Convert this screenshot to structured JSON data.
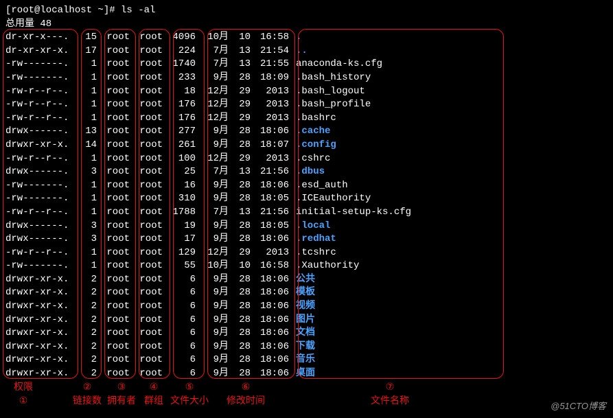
{
  "prompt": "[root@localhost ~]# ls -al",
  "total": "总用量 48",
  "rows": [
    {
      "perm": "dr-xr-x---.",
      "links": "15",
      "owner": "root",
      "group": "root",
      "size": "4096",
      "month": "10月",
      "day": "10",
      "time": "16:58",
      "name": ".",
      "dir": true
    },
    {
      "perm": "dr-xr-xr-x.",
      "links": "17",
      "owner": "root",
      "group": "root",
      "size": "224",
      "month": "7月",
      "day": "13",
      "time": "21:54",
      "name": "..",
      "dir": true
    },
    {
      "perm": "-rw-------.",
      "links": "1",
      "owner": "root",
      "group": "root",
      "size": "1740",
      "month": "7月",
      "day": "13",
      "time": "21:55",
      "name": "anaconda-ks.cfg",
      "dir": false
    },
    {
      "perm": "-rw-------.",
      "links": "1",
      "owner": "root",
      "group": "root",
      "size": "233",
      "month": "9月",
      "day": "28",
      "time": "18:09",
      "name": ".bash_history",
      "dir": false
    },
    {
      "perm": "-rw-r--r--.",
      "links": "1",
      "owner": "root",
      "group": "root",
      "size": "18",
      "month": "12月",
      "day": "29",
      "time": "2013",
      "name": ".bash_logout",
      "dir": false
    },
    {
      "perm": "-rw-r--r--.",
      "links": "1",
      "owner": "root",
      "group": "root",
      "size": "176",
      "month": "12月",
      "day": "29",
      "time": "2013",
      "name": ".bash_profile",
      "dir": false
    },
    {
      "perm": "-rw-r--r--.",
      "links": "1",
      "owner": "root",
      "group": "root",
      "size": "176",
      "month": "12月",
      "day": "29",
      "time": "2013",
      "name": ".bashrc",
      "dir": false
    },
    {
      "perm": "drwx------.",
      "links": "13",
      "owner": "root",
      "group": "root",
      "size": "277",
      "month": "9月",
      "day": "28",
      "time": "18:06",
      "name": ".cache",
      "dir": true
    },
    {
      "perm": "drwxr-xr-x.",
      "links": "14",
      "owner": "root",
      "group": "root",
      "size": "261",
      "month": "9月",
      "day": "28",
      "time": "18:07",
      "name": ".config",
      "dir": true
    },
    {
      "perm": "-rw-r--r--.",
      "links": "1",
      "owner": "root",
      "group": "root",
      "size": "100",
      "month": "12月",
      "day": "29",
      "time": "2013",
      "name": ".cshrc",
      "dir": false
    },
    {
      "perm": "drwx------.",
      "links": "3",
      "owner": "root",
      "group": "root",
      "size": "25",
      "month": "7月",
      "day": "13",
      "time": "21:56",
      "name": ".dbus",
      "dir": true
    },
    {
      "perm": "-rw-------.",
      "links": "1",
      "owner": "root",
      "group": "root",
      "size": "16",
      "month": "9月",
      "day": "28",
      "time": "18:06",
      "name": ".esd_auth",
      "dir": false
    },
    {
      "perm": "-rw-------.",
      "links": "1",
      "owner": "root",
      "group": "root",
      "size": "310",
      "month": "9月",
      "day": "28",
      "time": "18:05",
      "name": ".ICEauthority",
      "dir": false
    },
    {
      "perm": "-rw-r--r--.",
      "links": "1",
      "owner": "root",
      "group": "root",
      "size": "1788",
      "month": "7月",
      "day": "13",
      "time": "21:56",
      "name": "initial-setup-ks.cfg",
      "dir": false
    },
    {
      "perm": "drwx------.",
      "links": "3",
      "owner": "root",
      "group": "root",
      "size": "19",
      "month": "9月",
      "day": "28",
      "time": "18:05",
      "name": ".local",
      "dir": true
    },
    {
      "perm": "drwx------.",
      "links": "3",
      "owner": "root",
      "group": "root",
      "size": "17",
      "month": "9月",
      "day": "28",
      "time": "18:06",
      "name": ".redhat",
      "dir": true
    },
    {
      "perm": "-rw-r--r--.",
      "links": "1",
      "owner": "root",
      "group": "root",
      "size": "129",
      "month": "12月",
      "day": "29",
      "time": "2013",
      "name": ".tcshrc",
      "dir": false
    },
    {
      "perm": "-rw-------.",
      "links": "1",
      "owner": "root",
      "group": "root",
      "size": "55",
      "month": "10月",
      "day": "10",
      "time": "16:58",
      "name": ".Xauthority",
      "dir": false
    },
    {
      "perm": "drwxr-xr-x.",
      "links": "2",
      "owner": "root",
      "group": "root",
      "size": "6",
      "month": "9月",
      "day": "28",
      "time": "18:06",
      "name": "公共",
      "dir": true
    },
    {
      "perm": "drwxr-xr-x.",
      "links": "2",
      "owner": "root",
      "group": "root",
      "size": "6",
      "month": "9月",
      "day": "28",
      "time": "18:06",
      "name": "模板",
      "dir": true
    },
    {
      "perm": "drwxr-xr-x.",
      "links": "2",
      "owner": "root",
      "group": "root",
      "size": "6",
      "month": "9月",
      "day": "28",
      "time": "18:06",
      "name": "视频",
      "dir": true
    },
    {
      "perm": "drwxr-xr-x.",
      "links": "2",
      "owner": "root",
      "group": "root",
      "size": "6",
      "month": "9月",
      "day": "28",
      "time": "18:06",
      "name": "图片",
      "dir": true
    },
    {
      "perm": "drwxr-xr-x.",
      "links": "2",
      "owner": "root",
      "group": "root",
      "size": "6",
      "month": "9月",
      "day": "28",
      "time": "18:06",
      "name": "文档",
      "dir": true
    },
    {
      "perm": "drwxr-xr-x.",
      "links": "2",
      "owner": "root",
      "group": "root",
      "size": "6",
      "month": "9月",
      "day": "28",
      "time": "18:06",
      "name": "下载",
      "dir": true
    },
    {
      "perm": "drwxr-xr-x.",
      "links": "2",
      "owner": "root",
      "group": "root",
      "size": "6",
      "month": "9月",
      "day": "28",
      "time": "18:06",
      "name": "音乐",
      "dir": true
    },
    {
      "perm": "drwxr-xr-x.",
      "links": "2",
      "owner": "root",
      "group": "root",
      "size": "6",
      "month": "9月",
      "day": "28",
      "time": "18:06",
      "name": "桌面",
      "dir": true
    }
  ],
  "labels": {
    "l1": "权限",
    "n1": "①",
    "l2": "链接数",
    "n2": "②",
    "l3": "拥有者",
    "n3": "③",
    "l4": "群组",
    "n4": "④",
    "l5": "文件大小",
    "n5": "⑤",
    "l6": "修改时间",
    "n6": "⑥",
    "l7": "文件名称",
    "n7": "⑦"
  },
  "watermark": "@51CTO博客"
}
